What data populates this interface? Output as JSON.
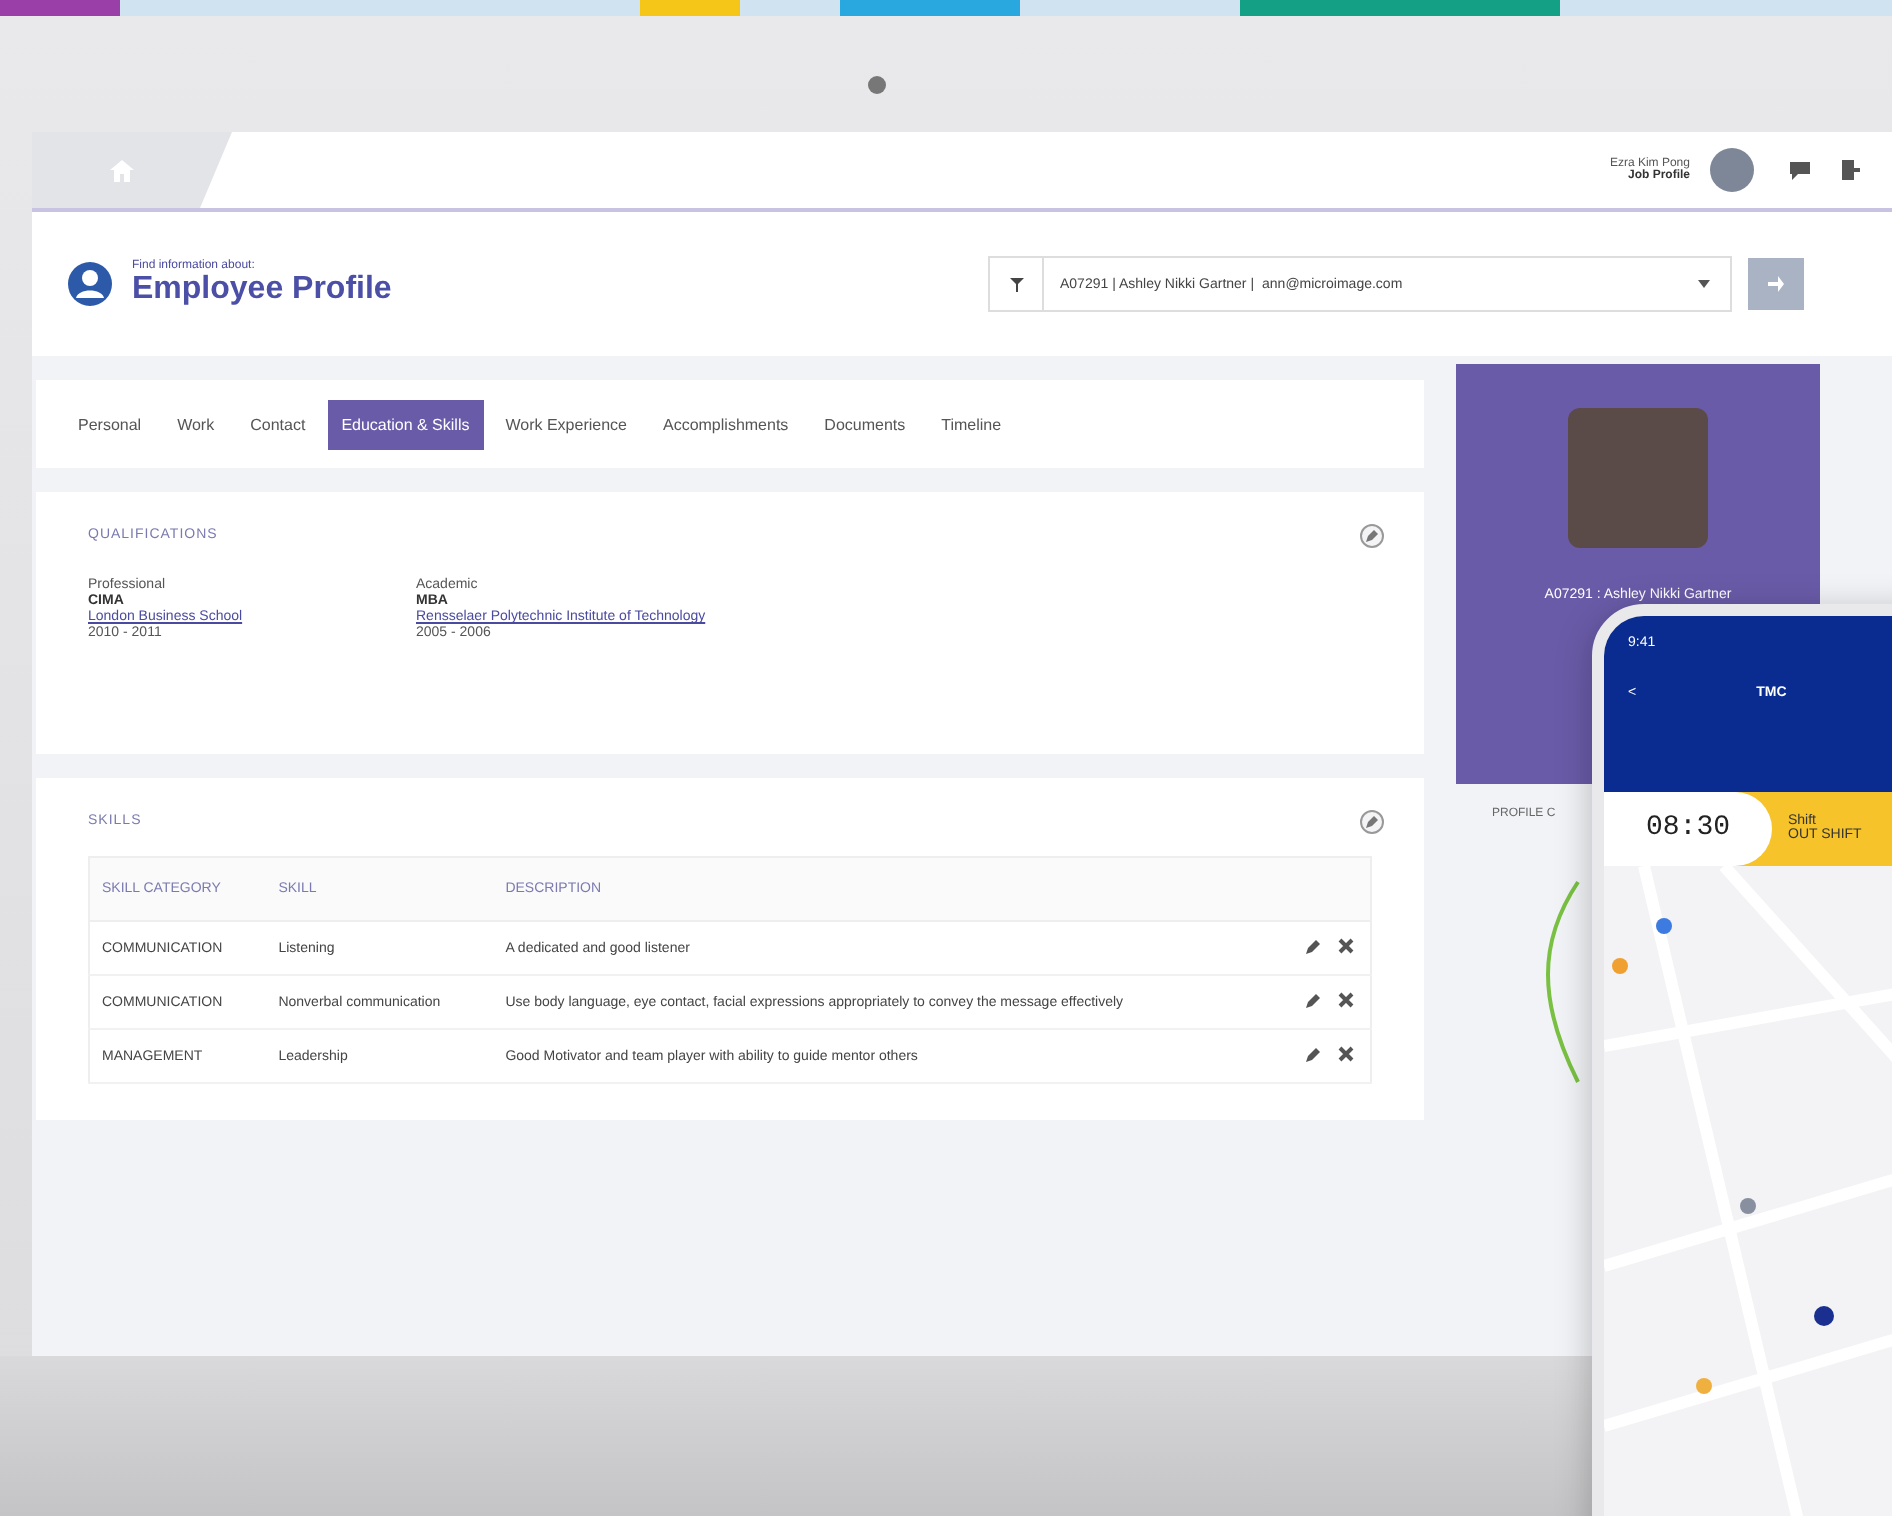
{
  "topbar": {
    "user_name": "Ezra Kim Pong",
    "user_role": "Job Profile"
  },
  "header": {
    "subtitle": "Find information about:",
    "title": "Employee Profile",
    "search_value": "A07291 | Ashley Nikki Gartner |",
    "search_email": "ann@microimage.com"
  },
  "tabs": [
    {
      "label": "Personal",
      "selected": false
    },
    {
      "label": "Work",
      "selected": false
    },
    {
      "label": "Contact",
      "selected": false
    },
    {
      "label": "Education & Skills",
      "selected": true
    },
    {
      "label": "Work Experience",
      "selected": false
    },
    {
      "label": "Accomplishments",
      "selected": false
    },
    {
      "label": "Documents",
      "selected": false
    },
    {
      "label": "Timeline",
      "selected": false
    }
  ],
  "qualifications": {
    "title": "QUALIFICATIONS",
    "columns": [
      {
        "type": "Professional",
        "degree": "CIMA",
        "institution": "London Business School",
        "years": "2010 - 2011"
      },
      {
        "type": "Academic",
        "degree": "MBA",
        "institution": "Rensselaer Polytechnic Institute of Technology",
        "years": "2005 - 2006"
      }
    ]
  },
  "skills": {
    "title": "SKILLS",
    "columns": [
      "SKILL CATEGORY",
      "SKILL",
      "DESCRIPTION"
    ],
    "rows": [
      {
        "category": "COMMUNICATION",
        "skill": "Listening",
        "description": "A dedicated and good listener"
      },
      {
        "category": "COMMUNICATION",
        "skill": "Nonverbal communication",
        "description": "Use body language, eye contact, facial expressions appropriately to convey the message effectively"
      },
      {
        "category": "MANAGEMENT",
        "skill": "Leadership",
        "description": "Good Motivator and team player with ability to guide mentor others"
      }
    ]
  },
  "profile_card": {
    "name": "A07291 : Ashley Nikki Gartner",
    "below": "PROFILE C"
  },
  "phone": {
    "time": "9:41",
    "back": "<",
    "title": "TMC",
    "clock": "08:30",
    "shift_label": "Shift",
    "shift_value": "OUT SHIFT"
  }
}
